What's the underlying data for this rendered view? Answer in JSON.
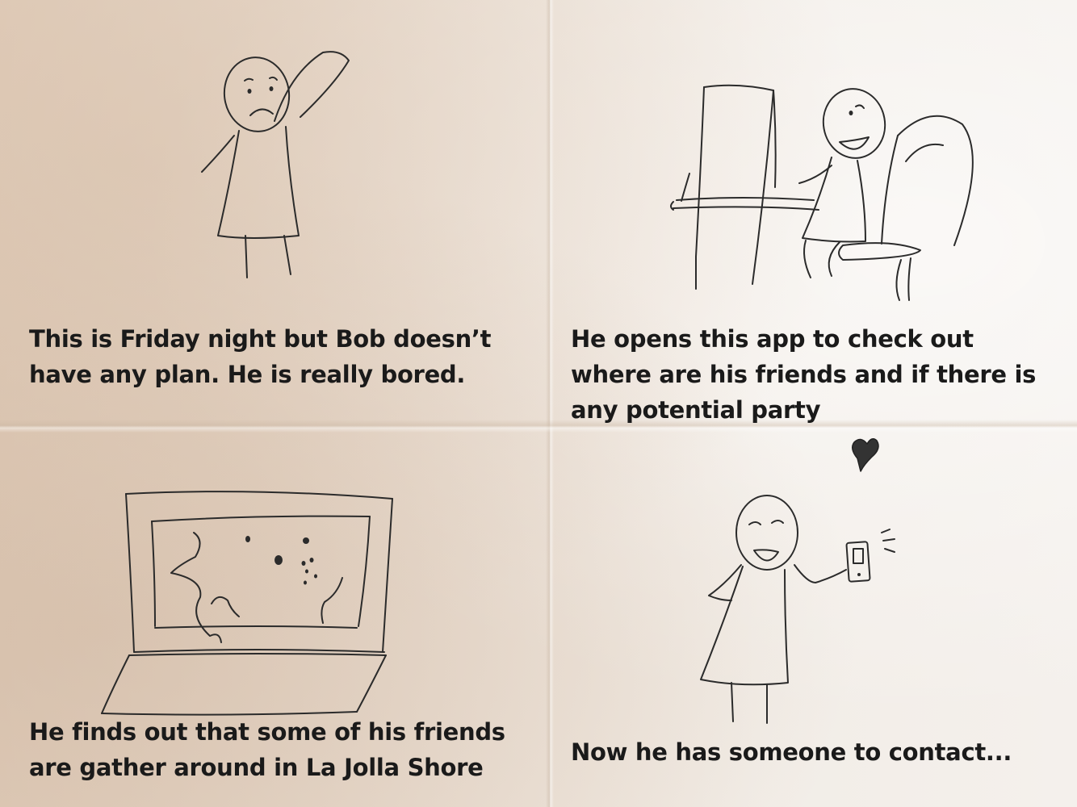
{
  "panels": [
    {
      "id": "friday-night",
      "caption": "This is Friday night but Bob doesn’t have any plan. He is really bored."
    },
    {
      "id": "opens-app",
      "caption": "He opens this app to check out where are his friends and if there is any potential party"
    },
    {
      "id": "finds-friends",
      "caption": "He finds out that some of his friends are gather around in La Jolla Shore"
    },
    {
      "id": "someone-to-contact",
      "caption": "Now he has someone to contact..."
    }
  ],
  "icons": [
    "bored-stick-figure",
    "seated-stick-figure-at-desk",
    "laptop-map-icon",
    "happy-stick-figure-with-phone",
    "heart-icon"
  ]
}
